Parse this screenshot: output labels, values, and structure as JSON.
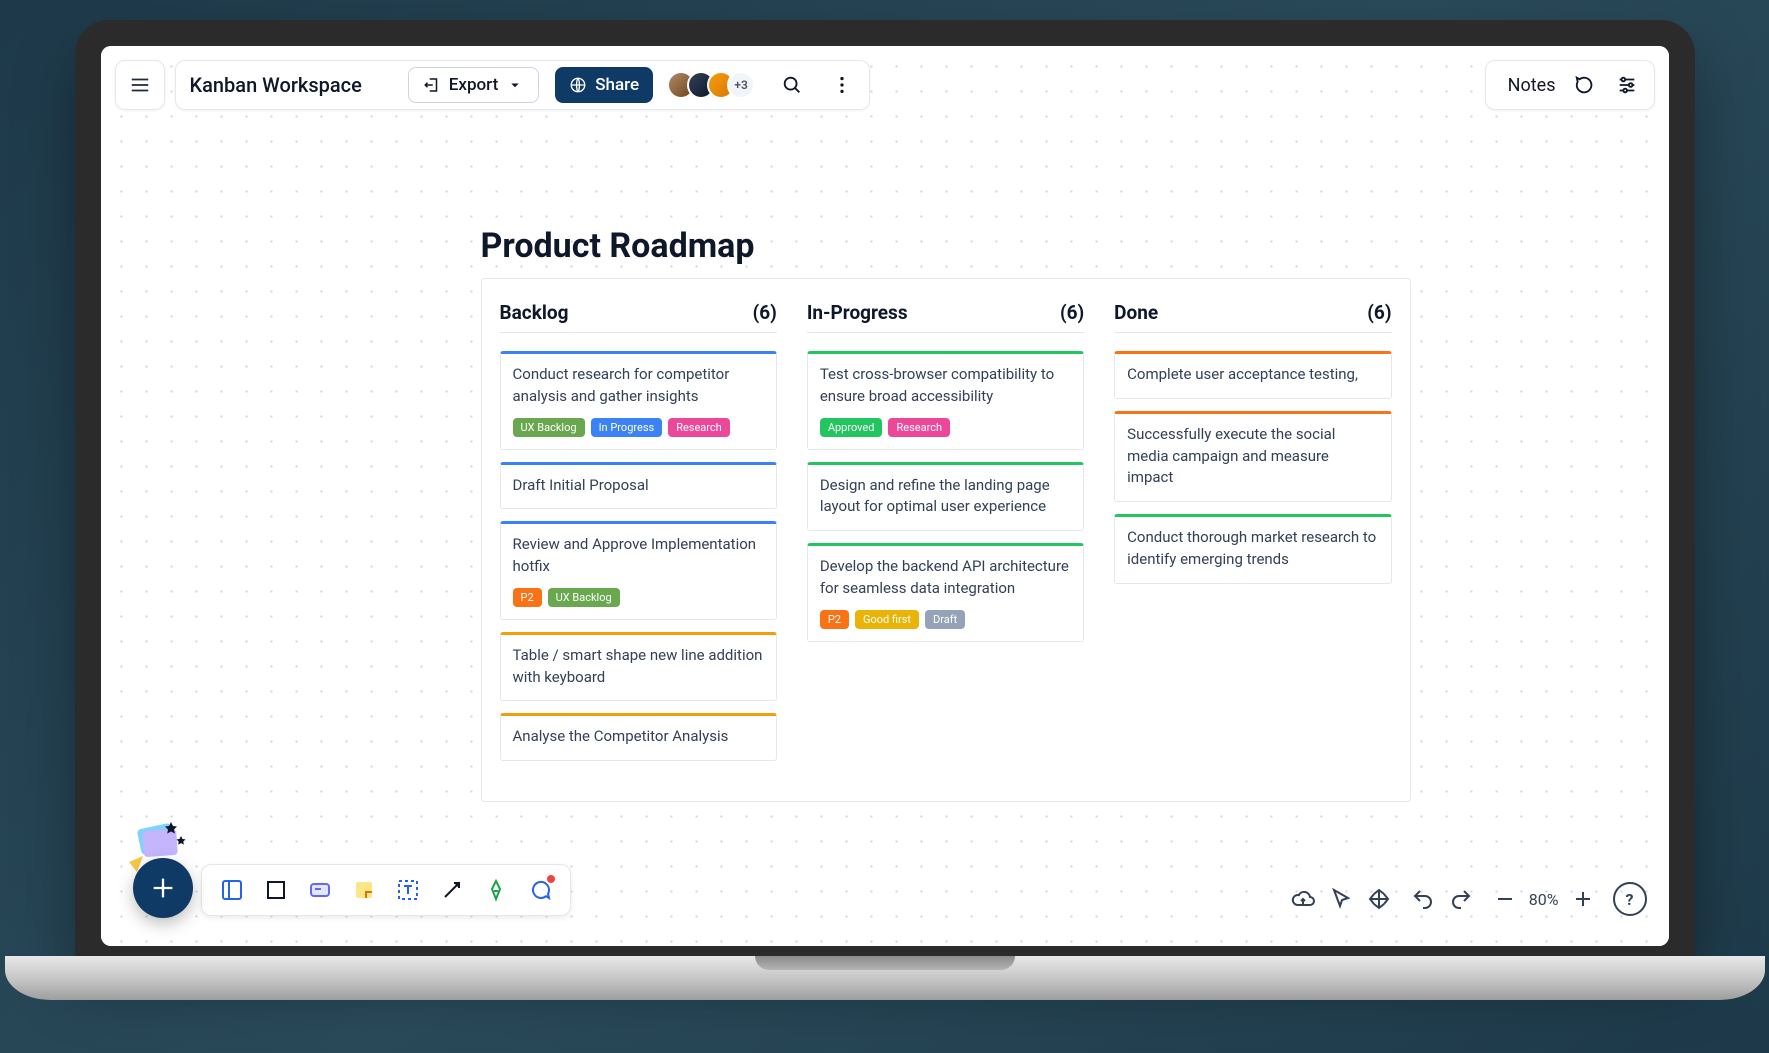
{
  "workspace": {
    "title": "Kanban Workspace"
  },
  "toolbar": {
    "export_label": "Export",
    "share_label": "Share",
    "notes_label": "Notes",
    "avatar_overflow": "+3"
  },
  "board": {
    "title": "Product Roadmap",
    "columns": [
      {
        "name": "Backlog",
        "count": "(6)",
        "cards": [
          {
            "bar": "#3b82f6",
            "text": "Conduct research for competitor analysis and gather insights",
            "tags": [
              {
                "label": "UX Backlog",
                "color": "#6aa84f"
              },
              {
                "label": "In Progress",
                "color": "#3b82f6"
              },
              {
                "label": "Research",
                "color": "#ec4899"
              }
            ]
          },
          {
            "bar": "#3b82f6",
            "text": "Draft Initial Proposal",
            "tags": []
          },
          {
            "bar": "#3b82f6",
            "text": "Review and Approve Implementation hotfix",
            "tags": [
              {
                "label": "P2",
                "color": "#f97316"
              },
              {
                "label": "UX Backlog",
                "color": "#6aa84f"
              }
            ]
          },
          {
            "bar": "#f59e0b",
            "text": "Table / smart shape new line addition with keyboard",
            "tags": []
          },
          {
            "bar": "#f59e0b",
            "text": "Analyse the Competitor Analysis",
            "tags": []
          }
        ]
      },
      {
        "name": "In-Progress",
        "count": "(6)",
        "cards": [
          {
            "bar": "#22c55e",
            "text": "Test cross-browser compatibility to ensure broad accessibility",
            "tags": [
              {
                "label": "Approved",
                "color": "#22c55e"
              },
              {
                "label": "Research",
                "color": "#ec4899"
              }
            ]
          },
          {
            "bar": "#22c55e",
            "text": "Design and refine the landing page layout for optimal user experience",
            "tags": []
          },
          {
            "bar": "#22c55e",
            "text": "Develop the backend API architecture for seamless data integration",
            "tags": [
              {
                "label": "P2",
                "color": "#f97316"
              },
              {
                "label": "Good first",
                "color": "#eab308"
              },
              {
                "label": "Draft",
                "color": "#94a3b8"
              }
            ]
          }
        ]
      },
      {
        "name": "Done",
        "count": "(6)",
        "cards": [
          {
            "bar": "#f97316",
            "text": "Complete user acceptance testing,",
            "tags": []
          },
          {
            "bar": "#f97316",
            "text": "Successfully execute the social media campaign and measure impact",
            "tags": []
          },
          {
            "bar": "#22c55e",
            "text": "Conduct thorough market research to identify emerging trends",
            "tags": []
          }
        ]
      }
    ]
  },
  "zoom": {
    "level": "80%"
  }
}
